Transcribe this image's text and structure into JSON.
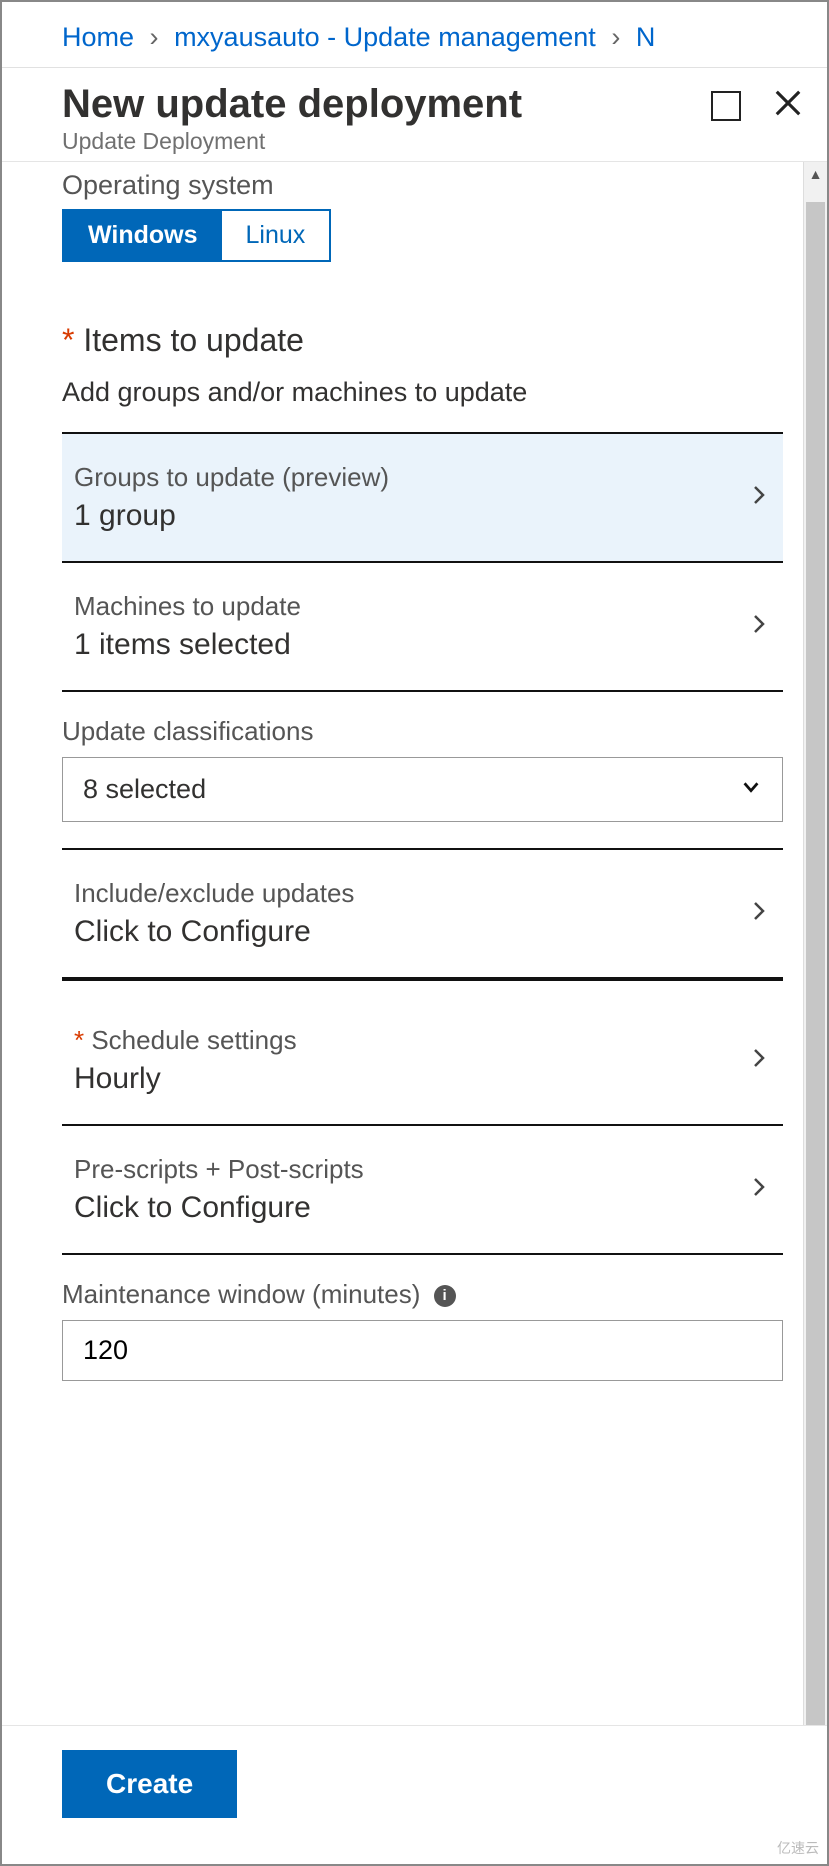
{
  "breadcrumb": {
    "home": "Home",
    "item2": "mxyausauto - Update management",
    "item3": "N"
  },
  "header": {
    "title": "New update deployment",
    "subtitle": "Update Deployment"
  },
  "form": {
    "os_label": "Operating system",
    "os_options": {
      "windows": "Windows",
      "linux": "Linux"
    },
    "items_title": "Items to update",
    "items_desc": "Add groups and/or machines to update",
    "groups": {
      "label": "Groups to update (preview)",
      "value": "1 group"
    },
    "machines": {
      "label": "Machines to update",
      "value": "1 items selected"
    },
    "classifications": {
      "label": "Update classifications",
      "value": "8 selected"
    },
    "include_exclude": {
      "label": "Include/exclude updates",
      "value": "Click to Configure"
    },
    "schedule": {
      "label": "Schedule settings",
      "value": "Hourly"
    },
    "scripts": {
      "label": "Pre-scripts + Post-scripts",
      "value": "Click to Configure"
    },
    "maint": {
      "label": "Maintenance window (minutes)",
      "value": "120"
    }
  },
  "footer": {
    "create": "Create"
  },
  "watermark": "亿速云"
}
